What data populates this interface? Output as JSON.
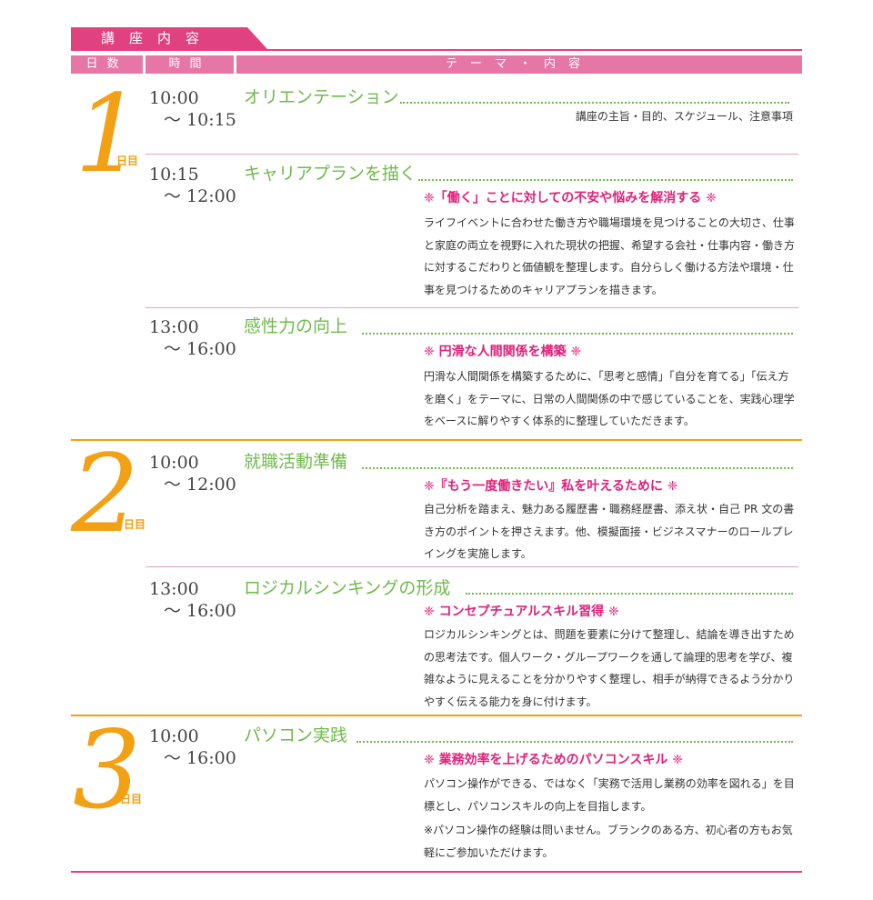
{
  "header": {
    "title": "講座内容",
    "columns": {
      "day": "日数",
      "time": "時間",
      "theme": "テーマ・内容"
    }
  },
  "colors": {
    "pink": "#e0427f",
    "orange": "#f2a014",
    "green": "#6fba4a",
    "magenta": "#e0217a"
  },
  "days": [
    {
      "num": "1",
      "label": "日目"
    },
    {
      "num": "2",
      "label": "日目"
    },
    {
      "num": "3",
      "label": "日目"
    }
  ],
  "sessions": [
    {
      "start": "10:00",
      "end": "～ 10:15",
      "title": "オリエンテーション",
      "note": "講座の主旨・目的、スケジュール、注意事項"
    },
    {
      "start": "10:15",
      "end": "～ 12:00",
      "title": "キャリアプランを描く",
      "subhead": "❈「働く」ことに対しての不安や悩みを解消する ❈",
      "body": "ライフイベントに合わせた働き方や職場環境を見つけることの大切さ、仕事と家庭の両立を視野に入れた現状の把握、希望する会社・仕事内容・働き方に対するこだわりと価値観を整理します。自分らしく働ける方法や環境・仕事を見つけるためのキャリアプランを描きます。"
    },
    {
      "start": "13:00",
      "end": "～ 16:00",
      "title": "感性力の向上",
      "subhead": "❈ 円滑な人間関係を構築 ❈",
      "body": "円滑な人間関係を構築するために、「思考と感情」「自分を育てる」「伝え方を磨く」をテーマに、日常の人間関係の中で感じていることを、実践心理学をベースに解りやすく体系的に整理していただきます。"
    },
    {
      "start": "10:00",
      "end": "～ 12:00",
      "title": "就職活動準備",
      "subhead": "❈『もう一度働きたい』私を叶えるために ❈",
      "body": "自己分析を踏まえ、魅力ある履歴書・職務経歴書、添え状・自己 PR 文の書き方のポイントを押さえます。他、模擬面接・ビジネスマナーのロールプレイングを実施します。"
    },
    {
      "start": "13:00",
      "end": "～ 16:00",
      "title": "ロジカルシンキングの形成",
      "subhead": "❈ コンセプチュアルスキル習得 ❈",
      "body": "ロジカルシンキングとは、問題を要素に分けて整理し、結論を導き出すための思考法です。個人ワーク・グループワークを通して論理的思考を学び、複雑なように見えることを分かりやすく整理し、相手が納得できるよう分かりやすく伝える能力を身に付けます。"
    },
    {
      "start": "10:00",
      "end": "～ 16:00",
      "title": "パソコン実践",
      "subhead": "❈ 業務効率を上げるためのパソコンスキル ❈",
      "body": "パソコン操作ができる、ではなく「実務で活用し業務の効率を図れる」を目標とし、パソコンスキルの向上を目指します。",
      "note2": "※パソコン操作の経験は問いません。ブランクのある方、初心者の方もお気軽にご参加いただけます。"
    }
  ]
}
